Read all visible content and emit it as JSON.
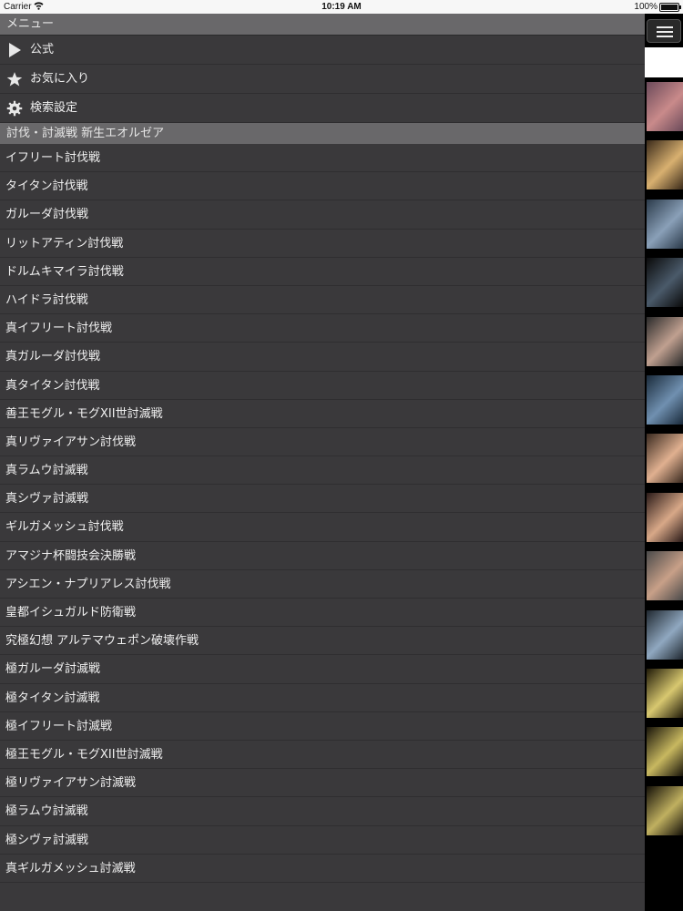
{
  "status_bar": {
    "carrier": "Carrier",
    "time": "10:19 AM",
    "battery": "100%",
    "battery_level": 1.0
  },
  "menu": {
    "header": "メニュー",
    "top_items": [
      {
        "label": "公式",
        "icon": "play-icon"
      },
      {
        "label": "お気に入り",
        "icon": "star-icon"
      },
      {
        "label": "検索設定",
        "icon": "gear-icon"
      }
    ],
    "section_title": "討伐・討滅戦 新生エオルゼア",
    "items": [
      "イフリート討伐戦",
      "タイタン討伐戦",
      "ガルーダ討伐戦",
      "リットアティン討伐戦",
      "ドルムキマイラ討伐戦",
      "ハイドラ討伐戦",
      "真イフリート討伐戦",
      "真ガルーダ討伐戦",
      "真タイタン討伐戦",
      "善王モグル・モグXII世討滅戦",
      "真リヴァイアサン討伐戦",
      "真ラムウ討滅戦",
      "真シヴァ討滅戦",
      "ギルガメッシュ討伐戦",
      "アマジナ杯闘技会決勝戦",
      "アシエン・ナプリアレス討伐戦",
      "皇都イシュガルド防衛戦",
      "究極幻想 アルテマウェポン破壊作戦",
      "極ガルーダ討滅戦",
      "極タイタン討滅戦",
      "極イフリート討滅戦",
      "極王モグル・モグXII世討滅戦",
      "極リヴァイアサン討滅戦",
      "極ラムウ討滅戦",
      "極シヴァ討滅戦",
      "真ギルガメッシュ討滅戦"
    ]
  },
  "colors": {
    "panel_bg": "#3a393b",
    "header_bg": "#69686a",
    "text": "#f0f0f0",
    "status_bg": "#f7f7f7"
  },
  "strip": {
    "menu_icon": "hamburger-menu-icon",
    "thumbnail_colors": [
      [
        "#6b4a5a",
        "#c98a8a"
      ],
      [
        "#3a2a1a",
        "#d8b070"
      ],
      [
        "#2b3a4a",
        "#8aa0b8"
      ],
      [
        "#0a0a0a",
        "#4a5a6a"
      ],
      [
        "#2a2a2a",
        "#c0a090"
      ],
      [
        "#1a2a3a",
        "#7090b0"
      ],
      [
        "#3a2a20",
        "#e0b090"
      ],
      [
        "#2a1a18",
        "#d8a888"
      ],
      [
        "#4a4a4a",
        "#c8a088"
      ],
      [
        "#202830",
        "#90a8c0"
      ],
      [
        "#201a08",
        "#d8c870"
      ],
      [
        "#18140a",
        "#c8b860"
      ],
      [
        "#141008",
        "#c0b060"
      ]
    ]
  }
}
